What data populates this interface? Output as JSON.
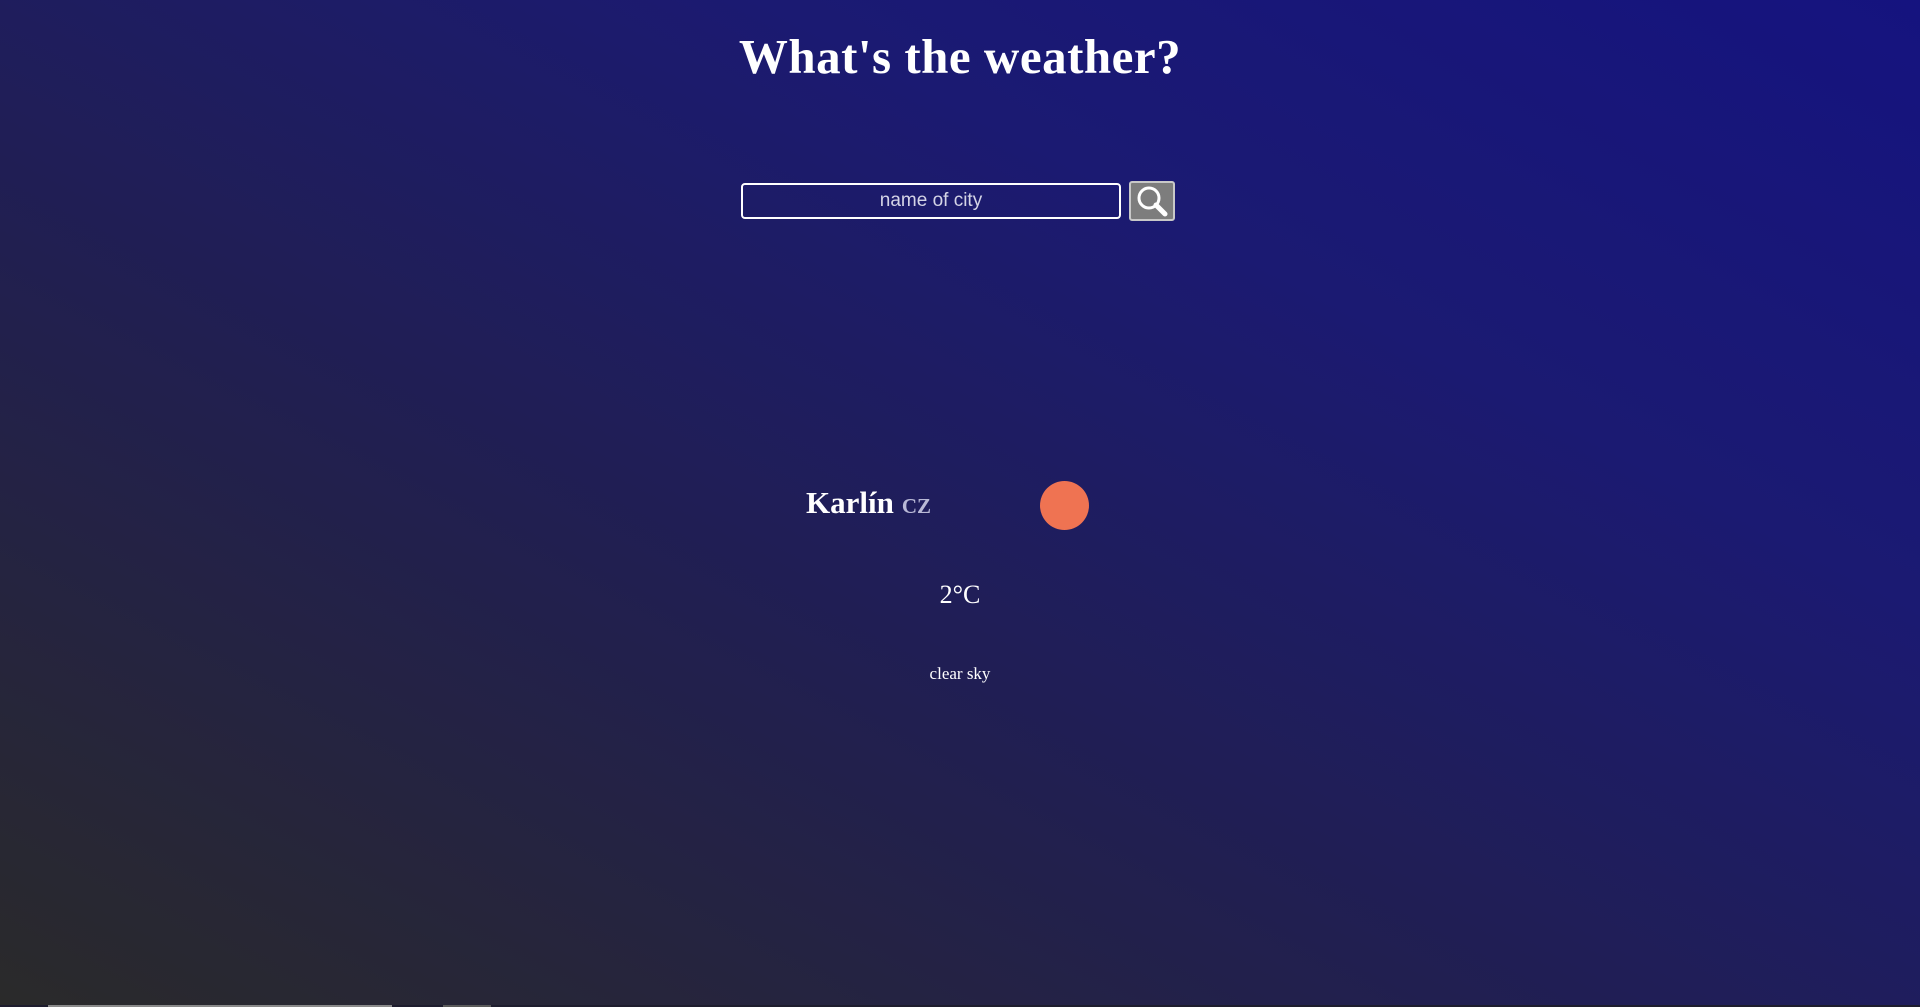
{
  "header": {
    "title": "What's the weather?"
  },
  "search": {
    "placeholder": "name of city",
    "value": "",
    "button_icon": "search-icon"
  },
  "weather": {
    "city": "Karlín",
    "country": "CZ",
    "temperature": "2°C",
    "description": "clear sky",
    "icon": "sun-icon"
  },
  "colors": {
    "sun": "#ef7352",
    "background_dark": "#2a2a2a",
    "background_blue": "#15137f",
    "button_bg": "#7d7d7d"
  }
}
